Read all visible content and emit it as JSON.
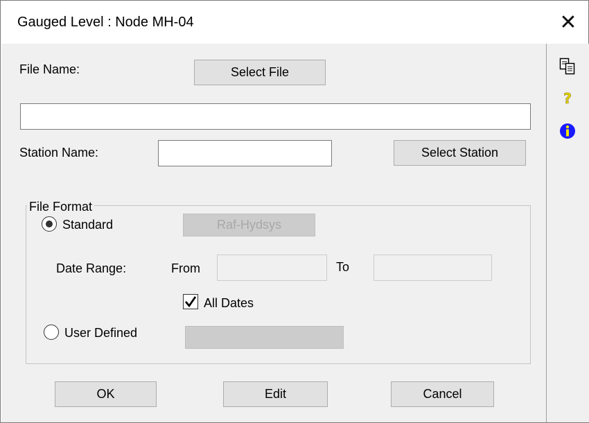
{
  "window": {
    "title": "Gauged Level : Node MH-04",
    "close_glyph": "✕"
  },
  "form": {
    "file_name_label": "File Name:",
    "select_file_label": "Select File",
    "file_path_value": "",
    "station_name_label": "Station Name:",
    "station_name_value": "",
    "select_station_label": "Select Station",
    "file_format_legend": "File Format",
    "standard_label": "Standard",
    "standard_selected": true,
    "raf_hydsys_label": "Raf-Hydsys",
    "date_range_label": "Date Range:",
    "from_label": "From",
    "from_value": "",
    "to_label": "To",
    "to_value": "",
    "all_dates_label": "All Dates",
    "all_dates_checked": true,
    "user_defined_label": "User Defined",
    "user_defined_selected": false,
    "user_defined_value": ""
  },
  "footer": {
    "ok_label": "OK",
    "edit_label": "Edit",
    "cancel_label": "Cancel"
  },
  "sidebar": {
    "icons": [
      {
        "name": "copy-icon"
      },
      {
        "name": "help-icon",
        "color": "#e6d200"
      },
      {
        "name": "info-icon",
        "color": "#1a1aff"
      }
    ]
  }
}
